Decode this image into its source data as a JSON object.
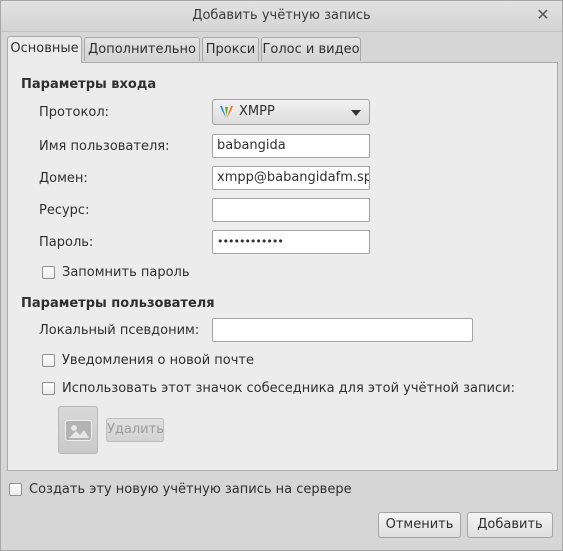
{
  "window": {
    "title": "Добавить учётную запись",
    "close_symbol": "✕"
  },
  "tabs": [
    {
      "label": "Основные",
      "active": true
    },
    {
      "label": "Дополнительно",
      "active": false
    },
    {
      "label": "Прокси",
      "active": false
    },
    {
      "label": "Голос и видео",
      "active": false
    }
  ],
  "login": {
    "section_title": "Параметры входа",
    "protocol_label": "Протокол:",
    "protocol_value": "XMPP",
    "protocol_icon": "xmpp-icon",
    "username_label": "Имя пользователя:",
    "username_value": "babangida",
    "domain_label": "Домен:",
    "domain_value": "xmpp@babangidafm.spa",
    "resource_label": "Ресурс:",
    "resource_value": "",
    "password_label": "Пароль:",
    "password_masked": "••••••••••••",
    "remember_label": "Запомнить пароль",
    "remember_checked": false
  },
  "user": {
    "section_title": "Параметры пользователя",
    "alias_label": "Локальный псевдоним:",
    "alias_value": "",
    "mail_notify_label": "Уведомления о новой почте",
    "mail_notify_checked": false,
    "buddy_icon_label": "Использовать этот значок собеседника для этой учётной записи:",
    "buddy_icon_checked": false,
    "remove_label": "Удалить"
  },
  "footer": {
    "create_on_server_label": "Создать эту новую учётную запись на сервере",
    "create_on_server_checked": false,
    "cancel_label": "Отменить",
    "add_label": "Добавить"
  },
  "colors": {
    "window_bg": "#d6d6d6",
    "panel_bg": "#ececec",
    "border": "#a9a9a9"
  }
}
